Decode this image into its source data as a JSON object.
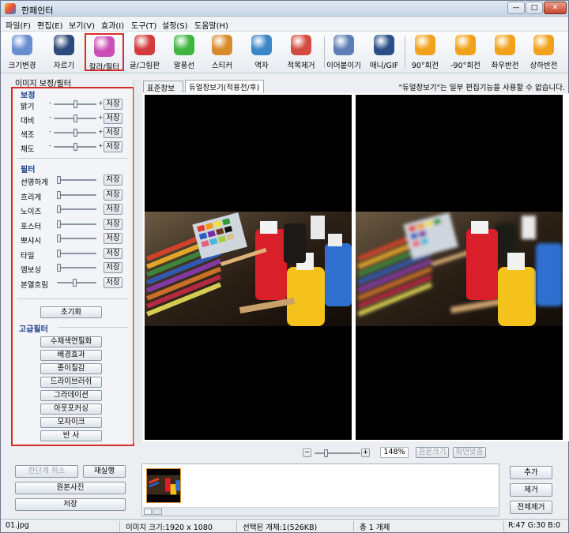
{
  "window": {
    "title": "한페인터",
    "buttons": [
      "—",
      "□",
      "✕"
    ]
  },
  "menu": [
    "파일(F)",
    "편집(E)",
    "보기(V)",
    "효과(I)",
    "도구(T)",
    "설정(S)",
    "도움말(H)"
  ],
  "toolbar": {
    "items": [
      {
        "label": "크기변경",
        "icon": "resize-icon",
        "color": "#6a8fd0"
      },
      {
        "label": "자르기",
        "icon": "crop-icon",
        "color": "#2e4a7a"
      },
      {
        "label": "칼라/필터",
        "icon": "color-filter-icon",
        "color": "#c94fb7",
        "selected": true
      },
      {
        "label": "글/그림판",
        "icon": "text-draw-icon",
        "color": "#d23c3c"
      },
      {
        "label": "말풍선",
        "icon": "speech-bubble-icon",
        "color": "#3fb53f"
      },
      {
        "label": "스티커",
        "icon": "sticker-icon",
        "color": "#d98a2b"
      },
      {
        "label": "액자",
        "icon": "frame-icon",
        "color": "#3a86c8"
      },
      {
        "label": "적목제거",
        "icon": "red-eye-icon",
        "color": "#d44b3f"
      },
      {
        "label": "이어붙이기",
        "icon": "merge-icon",
        "color": "#5e7fb5"
      },
      {
        "label": "애니/GIF",
        "icon": "gif-icon",
        "color": "#2c4f86"
      },
      {
        "label": "90°회전",
        "icon": "rotate-cw-icon",
        "color": "#f2a21a"
      },
      {
        "label": "-90°회전",
        "icon": "rotate-ccw-icon",
        "color": "#f2a21a"
      },
      {
        "label": "좌우반전",
        "icon": "flip-horizontal-icon",
        "color": "#f2a21a"
      },
      {
        "label": "상하반전",
        "icon": "flip-vertical-icon",
        "color": "#f2a21a"
      }
    ]
  },
  "left_panel": {
    "title": "이미지 보정/필터",
    "correction_title": "보정",
    "correction_rows": [
      {
        "label": "밝기",
        "value": 0.5
      },
      {
        "label": "대비",
        "value": 0.5
      },
      {
        "label": "색조",
        "value": 0.5
      },
      {
        "label": "채도",
        "value": 0.5
      }
    ],
    "filter_title": "필터",
    "filter_rows": [
      {
        "label": "선명하게",
        "value": 0.0
      },
      {
        "label": "흐리게",
        "value": 0.0
      },
      {
        "label": "노이즈",
        "value": 0.0
      },
      {
        "label": "포스터",
        "value": 0.0
      },
      {
        "label": "뽀샤시",
        "value": 0.0
      },
      {
        "label": "타일",
        "value": 0.0
      },
      {
        "label": "엠보싱",
        "value": 0.0
      },
      {
        "label": "본열흐림",
        "value": 0.45
      }
    ],
    "save_label": "저장",
    "plus": "+",
    "minus": "-",
    "reset_label": "초기화",
    "advanced_title": "고급필터",
    "advanced_buttons": [
      "수채색연필화",
      "배경효과",
      "종이질감",
      "드라이브러쉬",
      "그라데이션",
      "아웃포커싱",
      "모자이크",
      "반    사"
    ]
  },
  "tabs": [
    "표준창보기",
    "듀얼창보기(적용전/후)"
  ],
  "notice": "\"듀얼창보기\"는 일부 편집기능을 사용할 수 없습니다.",
  "zoom": {
    "value": "148%",
    "minus": "−",
    "plus": "+",
    "original_size": "원본크기",
    "fit_screen": "화면맞춤",
    "level": 0.22
  },
  "bottom_left": {
    "undo": "한단계 취소",
    "redo": "재실행",
    "original": "원본사진",
    "save": "저장"
  },
  "right_buttons": [
    "추가",
    "제거",
    "전체제거"
  ],
  "status": {
    "file": "01.jpg",
    "image_size": "이미지 크기:1920 x 1080",
    "selected": "선택된 개체:1(526KB)",
    "total": "총 1 개체",
    "rgb": "R:47 G:30 B:0"
  }
}
